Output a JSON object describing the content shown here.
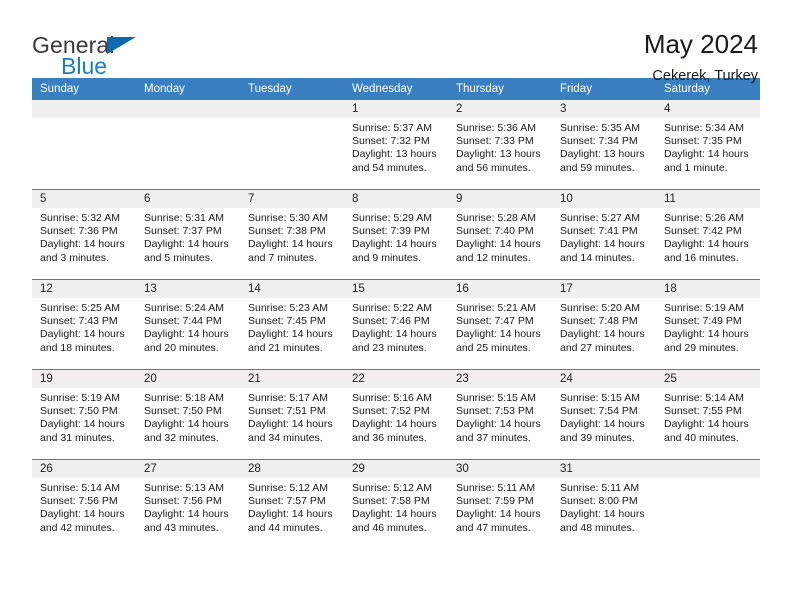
{
  "brand": {
    "name_top": "General",
    "name_bottom": "Blue",
    "accent_color": "#1b7ec2",
    "triangle_color": "#0b68b1"
  },
  "header": {
    "title": "May 2024",
    "subtitle": "Cekerek, Turkey"
  },
  "theme": {
    "header_bg": "#3a7fc1",
    "header_text": "#ffffff",
    "daynum_bg": "#f0f0f0",
    "cell_bg": "#ffffff",
    "grid_line": "#3a7fc1"
  },
  "weekday_headers": [
    "Sunday",
    "Monday",
    "Tuesday",
    "Wednesday",
    "Thursday",
    "Friday",
    "Saturday"
  ],
  "labels": {
    "sunrise": "Sunrise:",
    "sunset": "Sunset:",
    "daylight": "Daylight:"
  },
  "weeks": [
    [
      {
        "day": "",
        "empty": true,
        "sunrise": "",
        "sunset": "",
        "daylight": ""
      },
      {
        "day": "",
        "empty": true,
        "sunrise": "",
        "sunset": "",
        "daylight": ""
      },
      {
        "day": "",
        "empty": true,
        "sunrise": "",
        "sunset": "",
        "daylight": ""
      },
      {
        "day": "1",
        "empty": false,
        "sunrise": "Sunrise: 5:37 AM",
        "sunset": "Sunset: 7:32 PM",
        "daylight": "Daylight: 13 hours and 54 minutes."
      },
      {
        "day": "2",
        "empty": false,
        "sunrise": "Sunrise: 5:36 AM",
        "sunset": "Sunset: 7:33 PM",
        "daylight": "Daylight: 13 hours and 56 minutes."
      },
      {
        "day": "3",
        "empty": false,
        "sunrise": "Sunrise: 5:35 AM",
        "sunset": "Sunset: 7:34 PM",
        "daylight": "Daylight: 13 hours and 59 minutes."
      },
      {
        "day": "4",
        "empty": false,
        "sunrise": "Sunrise: 5:34 AM",
        "sunset": "Sunset: 7:35 PM",
        "daylight": "Daylight: 14 hours and 1 minute."
      }
    ],
    [
      {
        "day": "5",
        "empty": false,
        "sunrise": "Sunrise: 5:32 AM",
        "sunset": "Sunset: 7:36 PM",
        "daylight": "Daylight: 14 hours and 3 minutes."
      },
      {
        "day": "6",
        "empty": false,
        "sunrise": "Sunrise: 5:31 AM",
        "sunset": "Sunset: 7:37 PM",
        "daylight": "Daylight: 14 hours and 5 minutes."
      },
      {
        "day": "7",
        "empty": false,
        "sunrise": "Sunrise: 5:30 AM",
        "sunset": "Sunset: 7:38 PM",
        "daylight": "Daylight: 14 hours and 7 minutes."
      },
      {
        "day": "8",
        "empty": false,
        "sunrise": "Sunrise: 5:29 AM",
        "sunset": "Sunset: 7:39 PM",
        "daylight": "Daylight: 14 hours and 9 minutes."
      },
      {
        "day": "9",
        "empty": false,
        "sunrise": "Sunrise: 5:28 AM",
        "sunset": "Sunset: 7:40 PM",
        "daylight": "Daylight: 14 hours and 12 minutes."
      },
      {
        "day": "10",
        "empty": false,
        "sunrise": "Sunrise: 5:27 AM",
        "sunset": "Sunset: 7:41 PM",
        "daylight": "Daylight: 14 hours and 14 minutes."
      },
      {
        "day": "11",
        "empty": false,
        "sunrise": "Sunrise: 5:26 AM",
        "sunset": "Sunset: 7:42 PM",
        "daylight": "Daylight: 14 hours and 16 minutes."
      }
    ],
    [
      {
        "day": "12",
        "empty": false,
        "sunrise": "Sunrise: 5:25 AM",
        "sunset": "Sunset: 7:43 PM",
        "daylight": "Daylight: 14 hours and 18 minutes."
      },
      {
        "day": "13",
        "empty": false,
        "sunrise": "Sunrise: 5:24 AM",
        "sunset": "Sunset: 7:44 PM",
        "daylight": "Daylight: 14 hours and 20 minutes."
      },
      {
        "day": "14",
        "empty": false,
        "sunrise": "Sunrise: 5:23 AM",
        "sunset": "Sunset: 7:45 PM",
        "daylight": "Daylight: 14 hours and 21 minutes."
      },
      {
        "day": "15",
        "empty": false,
        "sunrise": "Sunrise: 5:22 AM",
        "sunset": "Sunset: 7:46 PM",
        "daylight": "Daylight: 14 hours and 23 minutes."
      },
      {
        "day": "16",
        "empty": false,
        "sunrise": "Sunrise: 5:21 AM",
        "sunset": "Sunset: 7:47 PM",
        "daylight": "Daylight: 14 hours and 25 minutes."
      },
      {
        "day": "17",
        "empty": false,
        "sunrise": "Sunrise: 5:20 AM",
        "sunset": "Sunset: 7:48 PM",
        "daylight": "Daylight: 14 hours and 27 minutes."
      },
      {
        "day": "18",
        "empty": false,
        "sunrise": "Sunrise: 5:19 AM",
        "sunset": "Sunset: 7:49 PM",
        "daylight": "Daylight: 14 hours and 29 minutes."
      }
    ],
    [
      {
        "day": "19",
        "empty": false,
        "sunrise": "Sunrise: 5:19 AM",
        "sunset": "Sunset: 7:50 PM",
        "daylight": "Daylight: 14 hours and 31 minutes."
      },
      {
        "day": "20",
        "empty": false,
        "sunrise": "Sunrise: 5:18 AM",
        "sunset": "Sunset: 7:50 PM",
        "daylight": "Daylight: 14 hours and 32 minutes."
      },
      {
        "day": "21",
        "empty": false,
        "sunrise": "Sunrise: 5:17 AM",
        "sunset": "Sunset: 7:51 PM",
        "daylight": "Daylight: 14 hours and 34 minutes."
      },
      {
        "day": "22",
        "empty": false,
        "sunrise": "Sunrise: 5:16 AM",
        "sunset": "Sunset: 7:52 PM",
        "daylight": "Daylight: 14 hours and 36 minutes."
      },
      {
        "day": "23",
        "empty": false,
        "sunrise": "Sunrise: 5:15 AM",
        "sunset": "Sunset: 7:53 PM",
        "daylight": "Daylight: 14 hours and 37 minutes."
      },
      {
        "day": "24",
        "empty": false,
        "sunrise": "Sunrise: 5:15 AM",
        "sunset": "Sunset: 7:54 PM",
        "daylight": "Daylight: 14 hours and 39 minutes."
      },
      {
        "day": "25",
        "empty": false,
        "sunrise": "Sunrise: 5:14 AM",
        "sunset": "Sunset: 7:55 PM",
        "daylight": "Daylight: 14 hours and 40 minutes."
      }
    ],
    [
      {
        "day": "26",
        "empty": false,
        "sunrise": "Sunrise: 5:14 AM",
        "sunset": "Sunset: 7:56 PM",
        "daylight": "Daylight: 14 hours and 42 minutes."
      },
      {
        "day": "27",
        "empty": false,
        "sunrise": "Sunrise: 5:13 AM",
        "sunset": "Sunset: 7:56 PM",
        "daylight": "Daylight: 14 hours and 43 minutes."
      },
      {
        "day": "28",
        "empty": false,
        "sunrise": "Sunrise: 5:12 AM",
        "sunset": "Sunset: 7:57 PM",
        "daylight": "Daylight: 14 hours and 44 minutes."
      },
      {
        "day": "29",
        "empty": false,
        "sunrise": "Sunrise: 5:12 AM",
        "sunset": "Sunset: 7:58 PM",
        "daylight": "Daylight: 14 hours and 46 minutes."
      },
      {
        "day": "30",
        "empty": false,
        "sunrise": "Sunrise: 5:11 AM",
        "sunset": "Sunset: 7:59 PM",
        "daylight": "Daylight: 14 hours and 47 minutes."
      },
      {
        "day": "31",
        "empty": false,
        "sunrise": "Sunrise: 5:11 AM",
        "sunset": "Sunset: 8:00 PM",
        "daylight": "Daylight: 14 hours and 48 minutes."
      },
      {
        "day": "",
        "empty": true,
        "sunrise": "",
        "sunset": "",
        "daylight": ""
      }
    ]
  ]
}
